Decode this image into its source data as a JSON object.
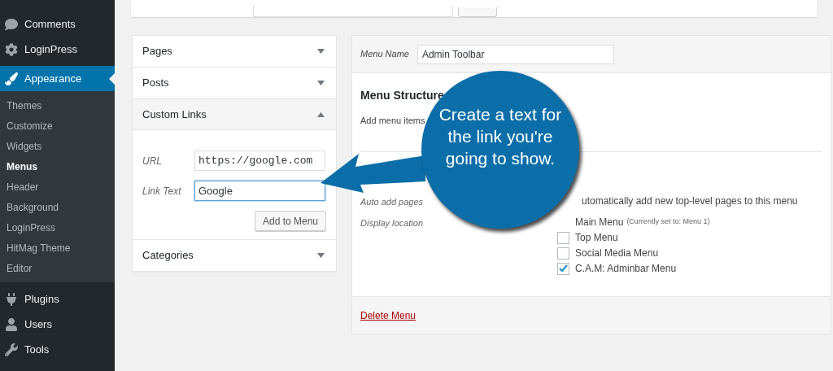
{
  "sidebar": {
    "items": [
      {
        "label": "Comments",
        "selected": false
      },
      {
        "label": "LoginPress",
        "selected": false
      },
      {
        "label": "Appearance",
        "selected": true,
        "children": [
          {
            "label": "Themes",
            "selected": false
          },
          {
            "label": "Customize",
            "selected": false
          },
          {
            "label": "Widgets",
            "selected": false
          },
          {
            "label": "Menus",
            "selected": true
          },
          {
            "label": "Header",
            "selected": false
          },
          {
            "label": "Background",
            "selected": false
          },
          {
            "label": "LoginPress",
            "selected": false
          },
          {
            "label": "HitMag Theme",
            "selected": false
          },
          {
            "label": "Editor",
            "selected": false
          }
        ]
      },
      {
        "label": "Plugins",
        "selected": false
      },
      {
        "label": "Users",
        "selected": false
      },
      {
        "label": "Tools",
        "selected": false
      }
    ]
  },
  "accordion": [
    {
      "title": "Pages",
      "expanded": false
    },
    {
      "title": "Posts",
      "expanded": false
    },
    {
      "title": "Custom Links",
      "expanded": true,
      "fields": [
        {
          "label": "URL",
          "value": "https://google.com",
          "kind": "mono",
          "focused": false
        },
        {
          "label": "Link Text",
          "value": "Google",
          "kind": "plain",
          "focused": true
        }
      ],
      "button": "Add to Menu"
    },
    {
      "title": "Categories",
      "expanded": false
    }
  ],
  "menu_editor": {
    "menu_name_label": "Menu Name",
    "menu_name_value": "Admin Toolbar",
    "structure_title": "Menu Structure",
    "structure_hint": "Add menu items",
    "auto_add_label": "Auto add pages",
    "auto_add_text": "utomatically add new top-level pages to this menu",
    "display_location_label": "Display location",
    "locations": [
      {
        "label": "Main Menu",
        "note": "(Currently set to: Menu 1)"
      },
      {
        "label": "Top Menu",
        "checked": false
      },
      {
        "label": "Social Media Menu",
        "checked": false
      },
      {
        "label": "C.A.M: Adminbar Menu",
        "checked": true
      }
    ],
    "delete_link": "Delete Menu"
  },
  "callout": {
    "text": "Create a text for the link you're going to show."
  }
}
